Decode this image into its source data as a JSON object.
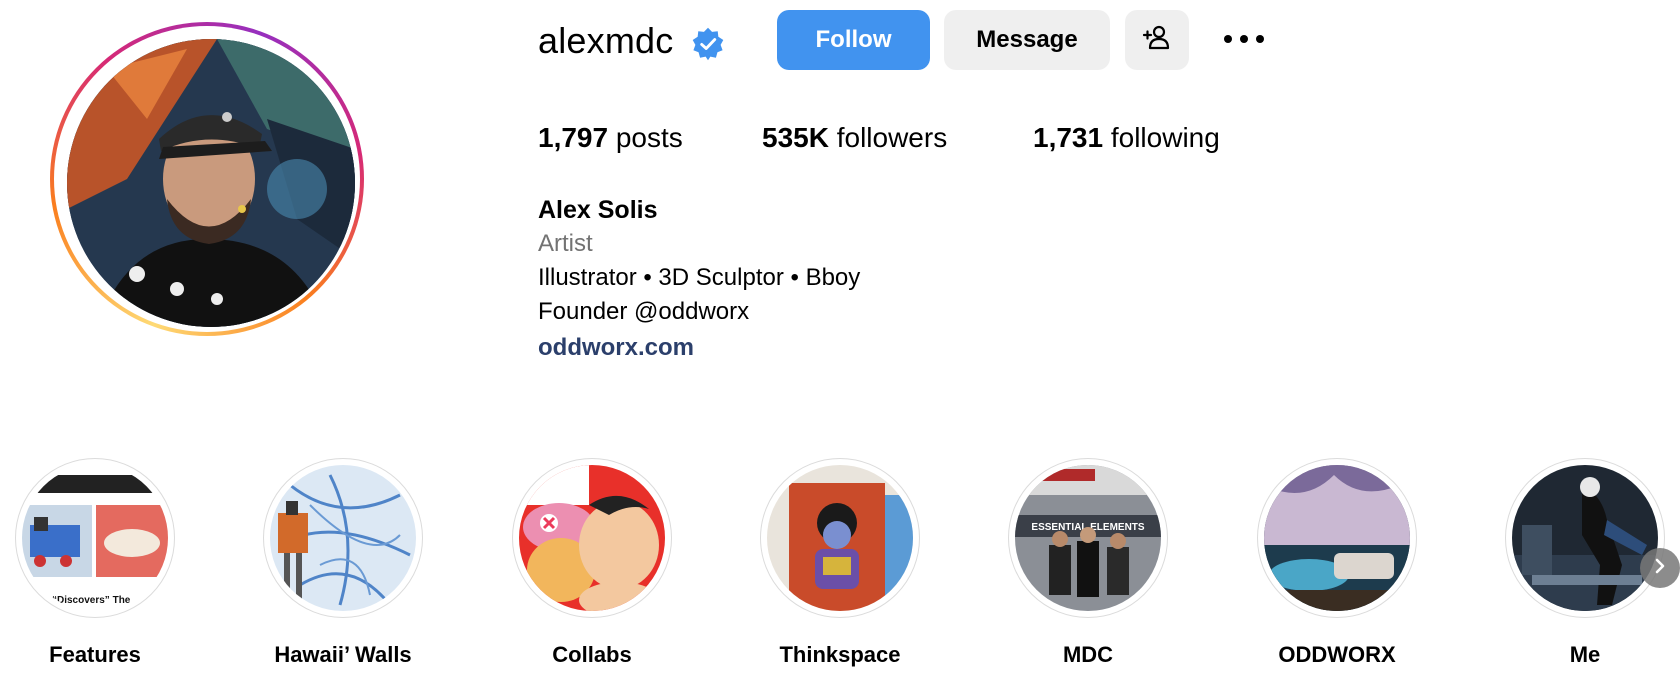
{
  "profile": {
    "username": "alexmdc",
    "verified_icon": "verified-badge-icon",
    "follow_label": "Follow",
    "message_label": "Message",
    "add_user_icon": "add-user-icon",
    "more_icon": "more-options-icon"
  },
  "stats": {
    "posts_count": "1,797",
    "posts_label": "posts",
    "followers_count": "535K",
    "followers_label": "followers",
    "following_count": "1,731",
    "following_label": "following"
  },
  "bio": {
    "name": "Alex Solis",
    "category": "Artist",
    "line1": "Illustrator • 3D Sculptor • Bboy",
    "line2": "Founder @oddworx",
    "link": "oddworx.com"
  },
  "highlights": [
    {
      "label": "Features"
    },
    {
      "label": "Hawaii’ Walls"
    },
    {
      "label": "Collabs"
    },
    {
      "label": "Thinkspace"
    },
    {
      "label": "MDC"
    },
    {
      "label": "ODDWORX"
    },
    {
      "label": "Me"
    }
  ],
  "highlight_thumbs": {
    "features_caption": "“Discovers” The",
    "mdc_banner": "ESSENTIAL ELEMENTS"
  },
  "colors": {
    "follow_button": "#4193ef",
    "secondary_button": "#efefef",
    "verified_badge": "#4193ef",
    "link": "#2b3f6b",
    "category_text": "#737373"
  },
  "next_icon": "chevron-right-icon"
}
